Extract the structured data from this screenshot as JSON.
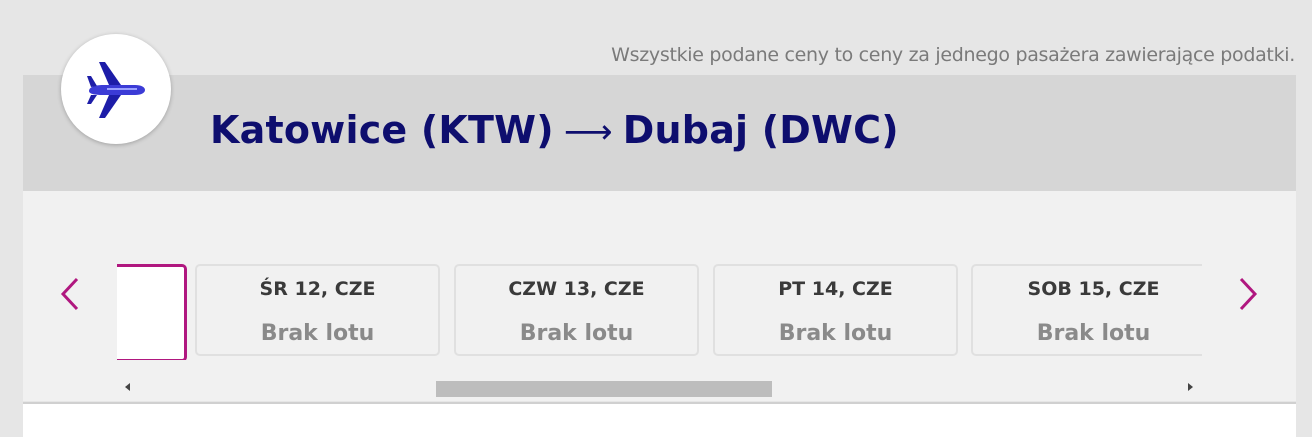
{
  "notice": "Wszystkie podane ceny to ceny za jednego pasażera zawierające podatki.",
  "route": {
    "origin": "Katowice (KTW)",
    "arrow": "⟶",
    "destination": "Dubaj (DWC)"
  },
  "icons": {
    "badge": "airplane-icon",
    "prev": "chevron-left-icon",
    "next": "chevron-right-icon"
  },
  "colors": {
    "accent": "#b0177f",
    "title": "#0e0e6e",
    "plane": "#3b3bd6"
  },
  "dates": [
    {
      "label": "ŚR 12, CZE",
      "status": "Brak lotu"
    },
    {
      "label": "CZW 13, CZE",
      "status": "Brak lotu"
    },
    {
      "label": "PT 14, CZE",
      "status": "Brak lotu"
    },
    {
      "label": "SOB 15, CZE",
      "status": "Brak lotu"
    }
  ]
}
